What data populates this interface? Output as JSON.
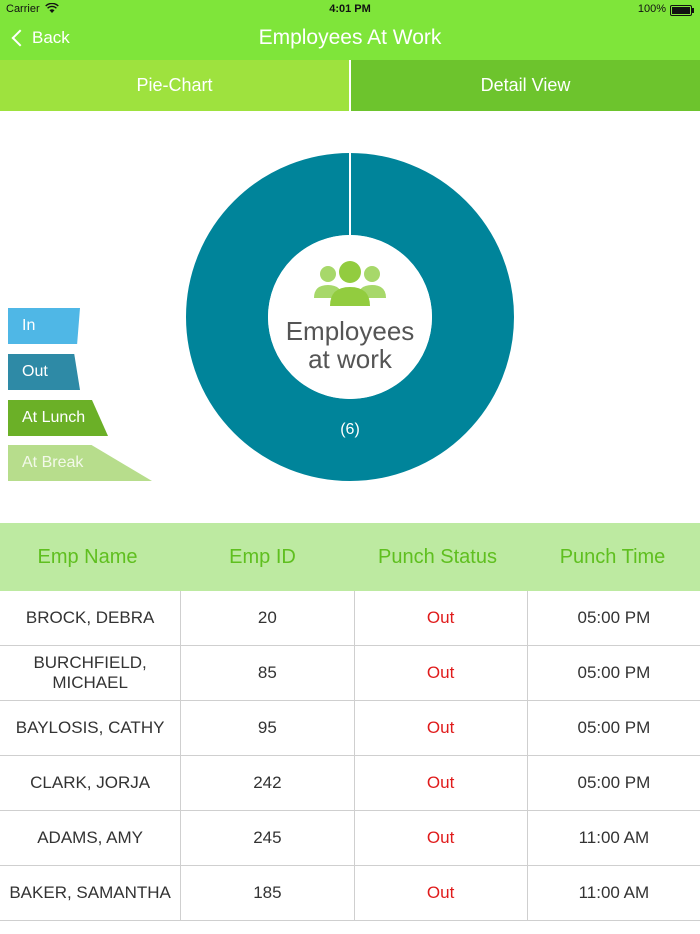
{
  "status_bar": {
    "carrier": "Carrier",
    "time": "4:01 PM",
    "battery": "100%"
  },
  "nav": {
    "back_label": "Back",
    "title": "Employees At Work"
  },
  "tabs": [
    {
      "label": "Pie-Chart"
    },
    {
      "label": "Detail View"
    }
  ],
  "legend": [
    {
      "label": "In",
      "color": "#4fb7e6"
    },
    {
      "label": "Out",
      "color": "#2e8aa6"
    },
    {
      "label": "At Lunch",
      "color": "#6bb027"
    },
    {
      "label": "At Break",
      "color": "#b7dd8c"
    }
  ],
  "chart_data": {
    "type": "pie",
    "center_text_line1": "Employees",
    "center_text_line2": "at work",
    "slices": [
      {
        "name": "Out",
        "value": 6,
        "label": "(6)",
        "color": "#00849a"
      }
    ]
  },
  "center_icon": "group-people-icon",
  "table": {
    "headers": [
      "Emp Name",
      "Emp ID",
      "Punch Status",
      "Punch Time"
    ],
    "rows": [
      {
        "name": "BROCK, DEBRA",
        "id": "20",
        "status": "Out",
        "time": "05:00 PM"
      },
      {
        "name": "BURCHFIELD, MICHAEL",
        "id": "85",
        "status": "Out",
        "time": "05:00 PM"
      },
      {
        "name": "BAYLOSIS, CATHY",
        "id": "95",
        "status": "Out",
        "time": "05:00 PM"
      },
      {
        "name": "CLARK, JORJA",
        "id": "242",
        "status": "Out",
        "time": "05:00 PM"
      },
      {
        "name": "ADAMS, AMY",
        "id": "245",
        "status": "Out",
        "time": "11:00 AM"
      },
      {
        "name": "BAKER, SAMANTHA",
        "id": "185",
        "status": "Out",
        "time": "11:00 AM"
      }
    ]
  }
}
